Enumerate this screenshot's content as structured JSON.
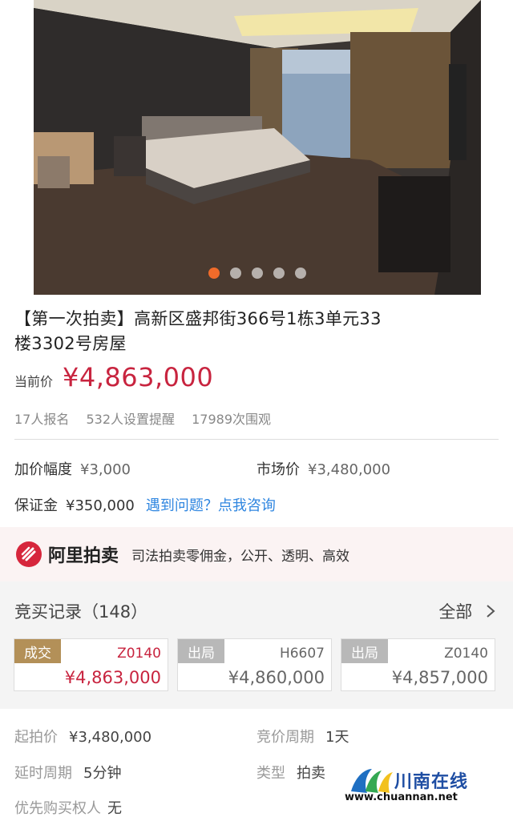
{
  "gallery": {
    "total": 5,
    "active": 0
  },
  "listing": {
    "title": "【第一次拍卖】高新区盛邦街366号1栋3单元33楼3302号房屋",
    "price_label": "当前价",
    "price": "¥4,863,000",
    "signups": "17人报名",
    "reminders": "532人设置提醒",
    "views": "17989次围观"
  },
  "terms": {
    "increment_label": "加价幅度",
    "increment": "¥3,000",
    "market_label": "市场价",
    "market": "¥3,480,000",
    "deposit_label": "保证金",
    "deposit": "¥350,000",
    "help_link": "遇到问题？点我咨询"
  },
  "banner": {
    "brand": "阿里拍卖",
    "slogan": "司法拍卖零佣金，公开、透明、高效",
    "color": "#d6263c"
  },
  "bids": {
    "title": "竞买记录（148）",
    "all_label": "全部",
    "records": [
      {
        "status": "成交",
        "bidder": "Z0140",
        "price": "¥4,863,000",
        "color": "#b39058",
        "price_color": "#c8243f"
      },
      {
        "status": "出局",
        "bidder": "H6607",
        "price": "¥4,860,000",
        "color": "#b8b8b8",
        "price_color": "#666666"
      },
      {
        "status": "出局",
        "bidder": "Z0140",
        "price": "¥4,857,000",
        "color": "#b8b8b8",
        "price_color": "#666666"
      }
    ]
  },
  "details": {
    "start_label": "起拍价",
    "start": "¥3,480,000",
    "cycle_label": "竞价周期",
    "cycle": "1天",
    "delay_label": "延时周期",
    "delay": "5分钟",
    "type_label": "类型",
    "type": "拍卖",
    "priority_label": "优先购买权人",
    "priority": "无"
  },
  "watermark": {
    "name": "川南在线",
    "url": "www.chuannan.net"
  }
}
